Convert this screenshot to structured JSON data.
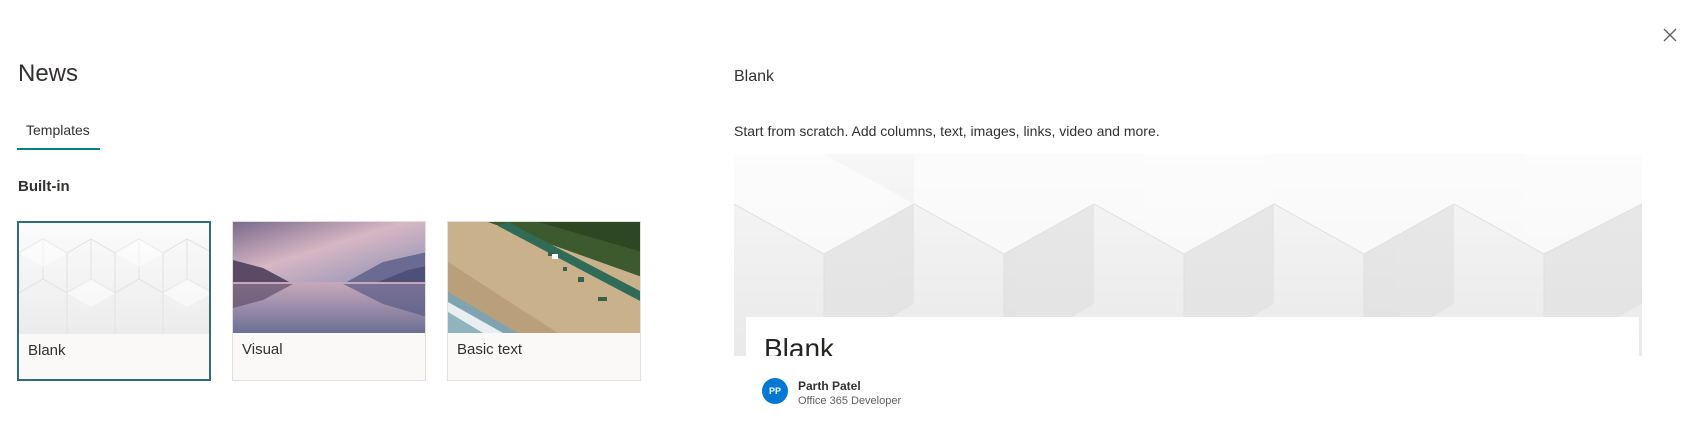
{
  "panel": {
    "title": "News",
    "tabs": [
      {
        "label": "Templates",
        "selected": true
      }
    ],
    "section_label": "Built-in",
    "templates": [
      {
        "label": "Blank",
        "selected": true,
        "thumbnail": "white-hexagon-pattern"
      },
      {
        "label": "Visual",
        "selected": false,
        "thumbnail": "misty-lake-mountains-photo"
      },
      {
        "label": "Basic text",
        "selected": false,
        "thumbnail": "aerial-beach-photo"
      }
    ]
  },
  "preview": {
    "title": "Blank",
    "description": "Start from scratch. Add columns, text, images, links, video and more.",
    "page_heading": "Blank",
    "author": {
      "initials": "PP",
      "name": "Parth Patel",
      "role": "Office 365 Developer"
    }
  },
  "icons": {
    "close": "close-icon"
  },
  "colors": {
    "accent": "#038387",
    "selected_border": "#2d6e75",
    "avatar": "#0078d4"
  }
}
